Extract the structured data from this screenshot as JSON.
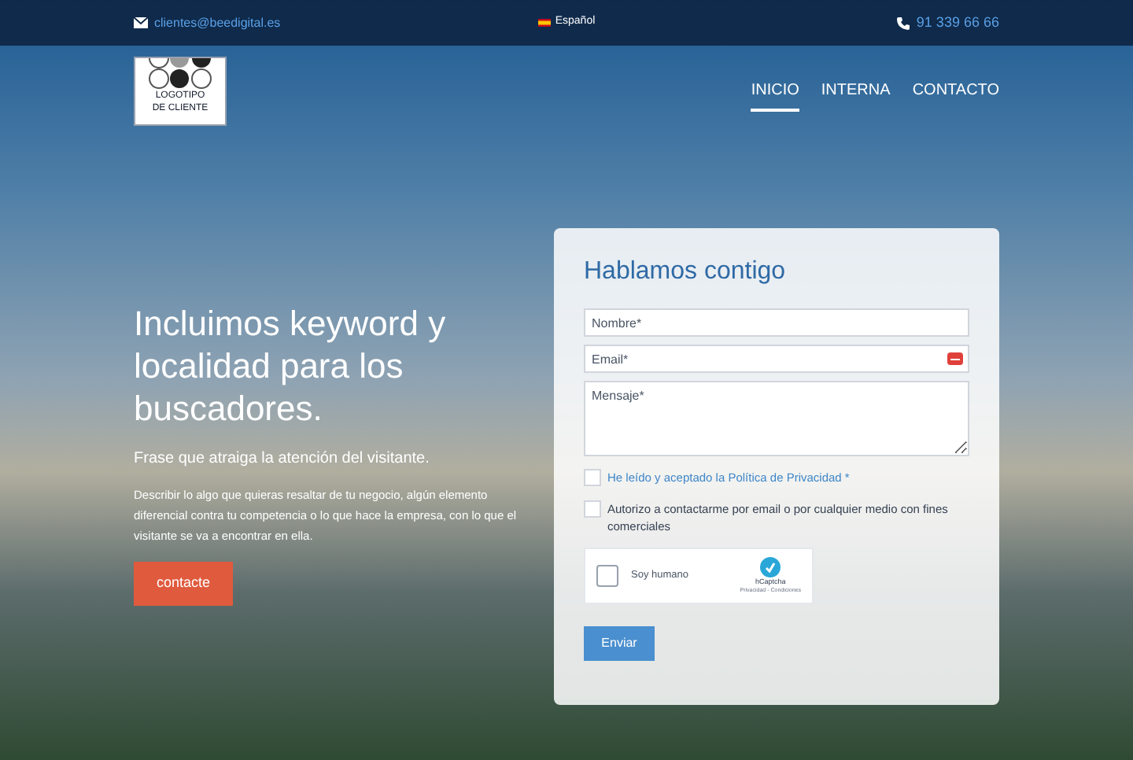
{
  "top_bar": {
    "email": "clientes@beedigital.es",
    "language": "Español",
    "phone": "91 339 66 66"
  },
  "logo": {
    "text": "LOGOTIPO DE CLIENTE"
  },
  "nav": [
    {
      "label": "INICIO",
      "selected": true
    },
    {
      "label": "INTERNA",
      "selected": false
    },
    {
      "label": "CONTACTO",
      "selected": false
    }
  ],
  "hero": {
    "title": "Incluimos keyword y localidad para los buscadores.",
    "subtitle": "Frase que atraiga la atención del visitante.",
    "description": "Describir lo algo que quieras resaltar de tu negocio, algún elemento diferencial contra tu competencia o lo que hace la empresa, con lo que el visitante se va a encontrar en ella.",
    "button": "contacte"
  },
  "form": {
    "title": "Hablamos contigo",
    "fields": [
      {
        "kind": "input",
        "placeholder": "Nombre*"
      },
      {
        "kind": "email",
        "placeholder": "Email*"
      },
      {
        "kind": "textarea",
        "placeholder": "Mensaje*"
      }
    ],
    "checkboxes": [
      {
        "label": "He leído y aceptado la Política de Privacidad *",
        "checked": false,
        "link": true
      },
      {
        "label": "Autorizo a contactarme por email o por cualquier medio con fines comerciales",
        "checked": false,
        "link": false
      }
    ],
    "captcha": {
      "label": "Soy humano",
      "brand": "hCaptcha",
      "links": "Privacidad - Condiciones",
      "checked": false
    },
    "submit": "Enviar"
  }
}
